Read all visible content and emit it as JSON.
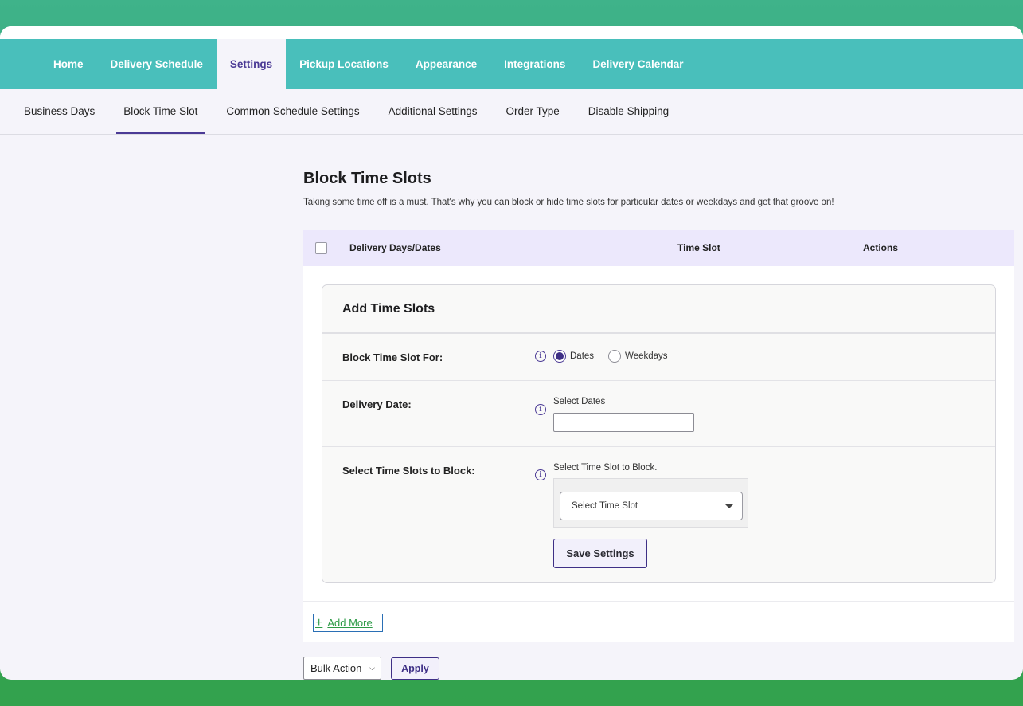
{
  "main_nav": {
    "items": [
      {
        "label": "Home"
      },
      {
        "label": "Delivery Schedule"
      },
      {
        "label": "Settings"
      },
      {
        "label": "Pickup Locations"
      },
      {
        "label": "Appearance"
      },
      {
        "label": "Integrations"
      },
      {
        "label": "Delivery Calendar"
      }
    ],
    "active": "Settings"
  },
  "sub_nav": {
    "items": [
      {
        "label": "Business Days"
      },
      {
        "label": "Block Time Slot"
      },
      {
        "label": "Common Schedule Settings"
      },
      {
        "label": "Additional Settings"
      },
      {
        "label": "Order Type"
      },
      {
        "label": "Disable Shipping"
      }
    ],
    "active": "Block Time Slot"
  },
  "page": {
    "title": "Block Time Slots",
    "description": "Taking some time off is a must. That's why you can block or hide time slots for particular dates or weekdays and get that groove on!"
  },
  "table": {
    "columns": [
      "Delivery Days/Dates",
      "Time Slot",
      "Actions"
    ]
  },
  "panel": {
    "title": "Add Time Slots",
    "block_for": {
      "label": "Block Time Slot For:",
      "options": [
        {
          "label": "Dates",
          "checked": true
        },
        {
          "label": "Weekdays",
          "checked": false
        }
      ]
    },
    "delivery_date": {
      "label": "Delivery Date:",
      "field_label": "Select Dates",
      "value": ""
    },
    "time_slots": {
      "label": "Select Time Slots to Block:",
      "field_label": "Select Time Slot to Block.",
      "placeholder": "Select Time Slot"
    },
    "save_label": "Save Settings"
  },
  "add_more_label": "Add More",
  "bulk": {
    "selected": "Bulk Action",
    "apply_label": "Apply"
  },
  "icons": {
    "info": "info-icon",
    "plus": "plus-icon",
    "dropdown": "caret-down-icon"
  },
  "colors": {
    "header_teal": "#49bfbb",
    "accent_purple": "#4b3a95",
    "table_head": "#ece8fc",
    "link_green": "#2e9b47"
  }
}
